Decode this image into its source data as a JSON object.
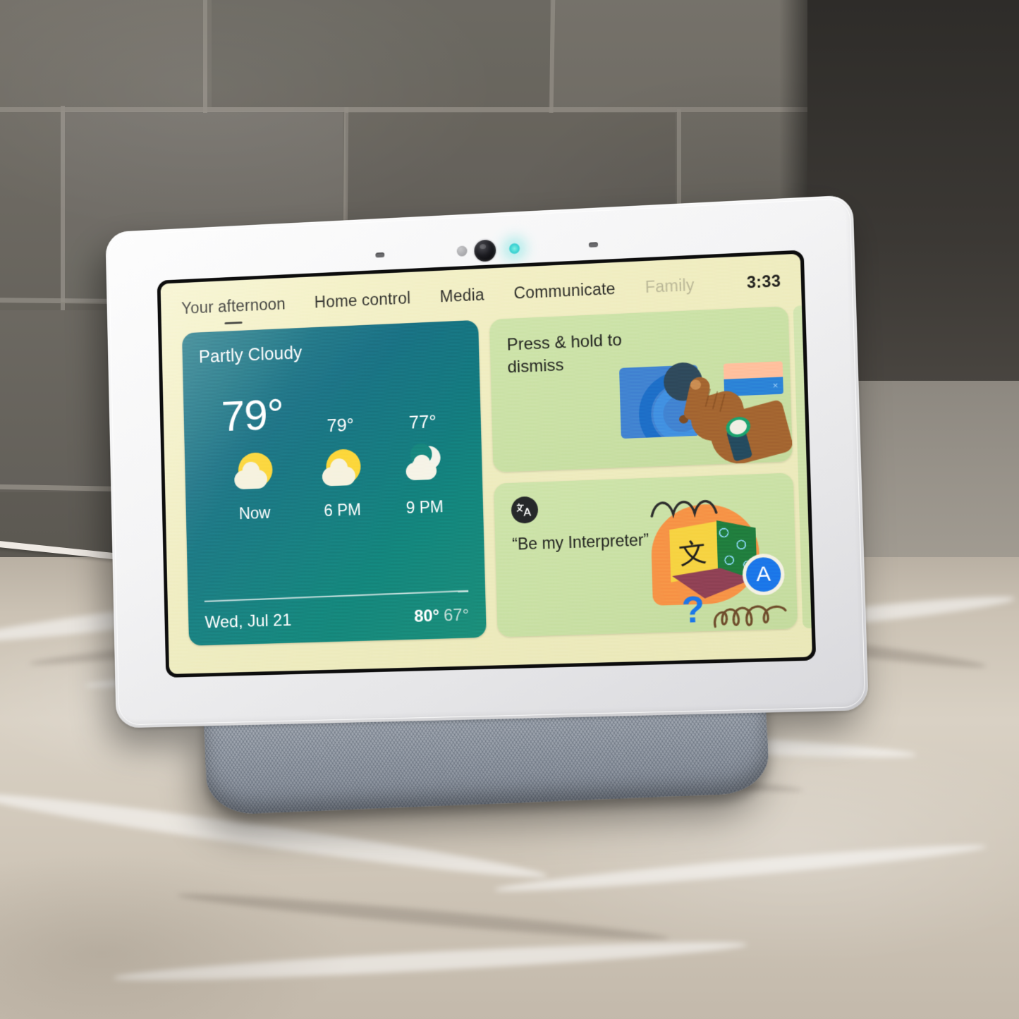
{
  "device": {
    "name": "Google Nest Hub Max",
    "bezel_sensors": [
      "mic-left",
      "ambient-light-sensor",
      "camera",
      "status-led",
      "mic-right"
    ]
  },
  "tabs": [
    {
      "label": "Your afternoon",
      "active": true,
      "dim": false
    },
    {
      "label": "Home control",
      "active": false,
      "dim": false
    },
    {
      "label": "Media",
      "active": false,
      "dim": false
    },
    {
      "label": "Communicate",
      "active": false,
      "dim": false
    },
    {
      "label": "Family",
      "active": false,
      "dim": true
    }
  ],
  "status": {
    "clock": "3:33"
  },
  "weather": {
    "condition": "Partly Cloudy",
    "current_temp": "79°",
    "forecast": [
      {
        "temp": "79°",
        "label": "Now",
        "icon": "partly-cloudy-day-icon"
      },
      {
        "temp": "79°",
        "label": "6 PM",
        "icon": "partly-cloudy-day-icon"
      },
      {
        "temp": "77°",
        "label": "9 PM",
        "icon": "partly-cloudy-night-icon"
      }
    ],
    "date": "Wed, Jul 21",
    "high": "80°",
    "low": "67°",
    "accent_start": "#17707f",
    "accent_end": "#1a8b76"
  },
  "cards": {
    "dismiss": {
      "title": "Press & hold to dismiss",
      "illustration": "hand-pressing-button-illustration",
      "bg": "#c8dfa2",
      "bar_x_label": "×"
    },
    "interpreter": {
      "badge_icon": "translate-icon",
      "quote": "“Be my Interpreter”",
      "illustration": "language-cube-speech-bubble-illustration",
      "cube_character": "文",
      "letter_badge": "A",
      "question_mark": "?",
      "bg": "#c8dfa2"
    }
  },
  "scene": {
    "wall": "gray-subway-tile",
    "counter": "beige-marble-countertop",
    "cable": "white-power-cable",
    "speaker_base": "gray-mesh-fabric-speaker"
  }
}
